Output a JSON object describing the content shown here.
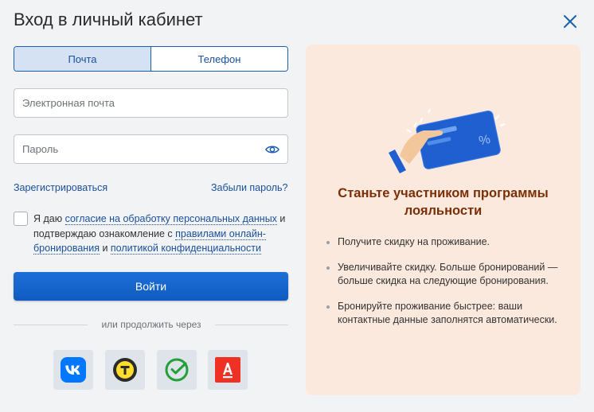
{
  "header": {
    "title": "Вход в личный кабинет",
    "close_icon": "close-icon"
  },
  "tabs": [
    {
      "label": "Почта",
      "active": true
    },
    {
      "label": "Телефон",
      "active": false
    }
  ],
  "form": {
    "email_placeholder": "Электронная почта",
    "email_value": "",
    "password_placeholder": "Пароль",
    "password_value": "",
    "register_link": "Зарегистрироваться",
    "forgot_link": "Забыли пароль?",
    "consent": {
      "checked": false,
      "part1": "Я даю ",
      "link1": "согласие на обработку персональных данных",
      "part2": " и подтверждаю ознакомление с ",
      "link2": "правилами онлайн-бронирования",
      "part3": " и ",
      "link3": "политикой конфиденциальности"
    },
    "login_button": "Войти",
    "divider_text": "или продолжить через",
    "social": [
      {
        "icon": "vk-icon",
        "color": "#0077ff"
      },
      {
        "icon": "tinkoff-icon",
        "color": "#ffdd2d"
      },
      {
        "icon": "sber-icon",
        "color": "#21a038"
      },
      {
        "icon": "alfa-icon",
        "color": "#ef3124"
      }
    ]
  },
  "promo": {
    "illustration_icon": "loyalty-card-hand-icon",
    "title": "Станьте участником программы лояльности",
    "bullets": [
      "Получите скидку на проживание.",
      "Увеличивайте скидку. Больше бронирований — больше скидка на следующие бронирования.",
      "Бронируйте проживание быстрее: ваши контактные данные заполнятся автоматически."
    ],
    "background": "#fce9de",
    "title_color": "#7a2f07"
  },
  "colors": {
    "accent": "#1a5fad",
    "button": "#1466cf"
  }
}
